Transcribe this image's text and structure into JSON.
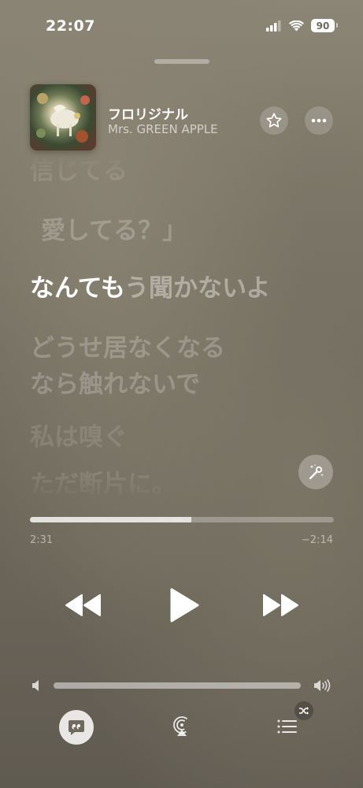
{
  "status_bar": {
    "time": "22:07",
    "battery": "90",
    "icons": [
      "signal-icon",
      "wifi-icon",
      "battery-icon"
    ]
  },
  "now_playing": {
    "title": "フロリジナル",
    "artist": "Mrs. GREEN APPLE",
    "buttons": [
      "star-icon",
      "more-icon"
    ]
  },
  "lyrics": {
    "lines": [
      {
        "text": "信じてる",
        "state": "past"
      },
      {
        "text": "愛してる？」",
        "state": "past"
      },
      {
        "sung": "なんても",
        "unsung": "う聞かないよ",
        "state": "current"
      },
      {
        "text": "どうせ居なくなる",
        "state": "upcoming"
      },
      {
        "text": "なら触れないで",
        "state": "upcoming"
      },
      {
        "text": "私は嗅ぐ",
        "state": "upcoming"
      },
      {
        "text": "ただ断片に。",
        "state": "upcoming"
      }
    ]
  },
  "playback": {
    "elapsed": "2:31",
    "remaining": "−2:14",
    "progress_fraction": 0.53,
    "volume_fraction": 1.0
  },
  "colors": {
    "background": "#6f6a5d",
    "accent": "#ffffff"
  }
}
